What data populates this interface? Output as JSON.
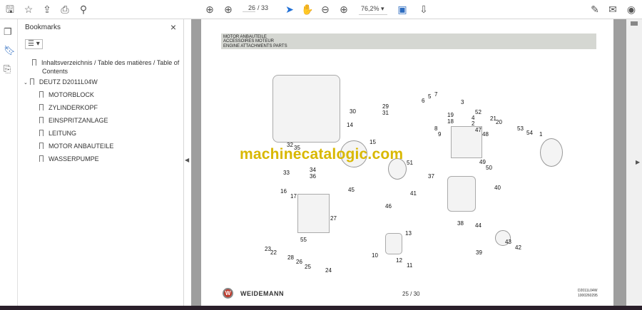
{
  "toolbar": {
    "page_current": "26",
    "page_total": "/ 33",
    "zoom": "76,2%"
  },
  "sidebar": {
    "title": "Bookmarks",
    "close": "×",
    "options": "☰ ▾",
    "items": [
      {
        "label": "Inhaltsverzeichnis / Table des matières / Table of",
        "label2": "Contents"
      },
      {
        "label": "DEUTZ D2011L04W"
      },
      {
        "label": "MOTORBLOCK"
      },
      {
        "label": "ZYLINDERKOPF"
      },
      {
        "label": "EINSPRITZANLAGE"
      },
      {
        "label": "LEITUNG"
      },
      {
        "label": "MOTOR ANBAUTEILE"
      },
      {
        "label": "WASSERPUMPE"
      }
    ]
  },
  "page": {
    "header": [
      "MOTOR ANBAUTEILE",
      "ACCESSOIRES MOTEUR",
      "ENGINE ATTACHMENTS PARTS"
    ],
    "watermark": "machinecatalogic.com",
    "brand": "WEIDEMANN",
    "page_number": "25 / 30",
    "doc_code": "D2011L04W",
    "doc_id": "1000260295",
    "part_numbers": [
      "30",
      "29",
      "31",
      "6",
      "5",
      "7",
      "3",
      "52",
      "4",
      "19",
      "18",
      "2",
      "8",
      "9",
      "47",
      "48",
      "21",
      "20",
      "53",
      "54",
      "1",
      "14",
      "15",
      "32",
      "35",
      "34",
      "36",
      "33",
      "51",
      "37",
      "41",
      "49",
      "50",
      "45",
      "46",
      "40",
      "16",
      "17",
      "27",
      "38",
      "44",
      "55",
      "13",
      "43",
      "42",
      "39",
      "23",
      "22",
      "28",
      "26",
      "25",
      "24",
      "10",
      "12",
      "11"
    ]
  }
}
